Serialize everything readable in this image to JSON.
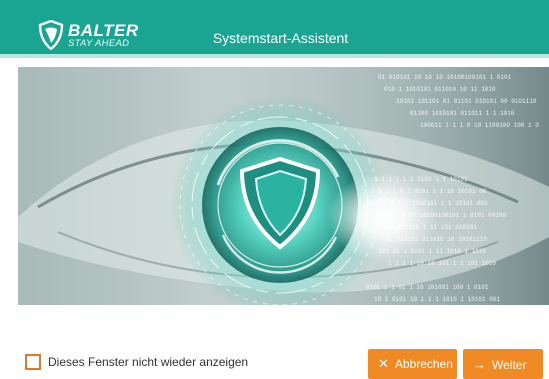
{
  "header": {
    "brand": "BALTER",
    "tagline": "STAY AHEAD",
    "title": "Systemstart-Assistent"
  },
  "hero": {
    "binary_lines": [
      "01 010101 10 10 10 10100100101 1 0101",
      "010 1 1010101 011010 10 11 1010",
      "10101 101101 01 01101 010101 00 0101110",
      "01100 1010101 011011 1 1 1010",
      "100011 1 1 1 0 10 1100100 100 1 0",
      "1 1 1 1 1 1 0101 1 1 10101",
      "1 1 1 1 1 0 1 0101 1 1 10 10101 00",
      "1 1010 1 1 1 1 1010101 1 1 10101 001",
      "101 10101 10 10 10100100101 1 0101 00100",
      "1 101 011010 1 11 101 010101",
      "01 010101 011010 10 10101110",
      "101 01 1 0101 1 11 1010 1 1010",
      "1 1 1 1 10 10 101 1 1 101 1010",
      "0101 1 1 01 1 10 101001 100 1 0101",
      "10 1 0101 10 1 1 1 1010 1 10101 001"
    ]
  },
  "footer": {
    "checkbox_label": "Dieses Fenster nicht wieder anzeigen",
    "cancel_label": "Abbrechen",
    "next_label": "Weiter"
  },
  "colors": {
    "header_bg": "#1aa592",
    "accent_orange": "#f08a24",
    "checkbox_border": "#e07a2a"
  },
  "icons": {
    "brand_logo": "shield-logo-icon",
    "cancel": "x-icon",
    "next": "arrow-right-icon"
  }
}
